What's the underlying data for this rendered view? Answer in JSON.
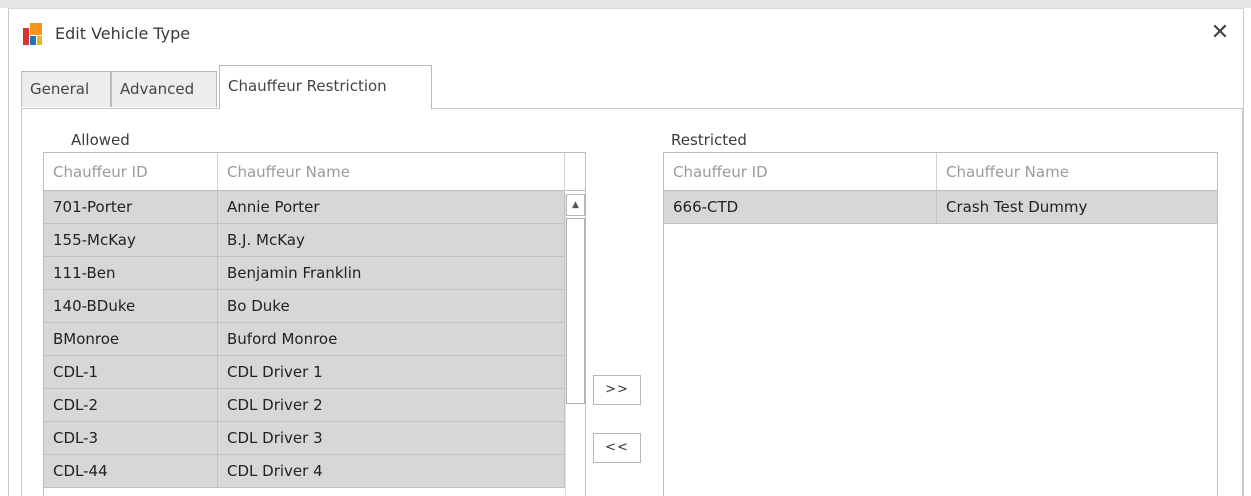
{
  "window": {
    "title": "Edit Vehicle Type"
  },
  "tabs": [
    {
      "label": "General"
    },
    {
      "label": "Advanced"
    },
    {
      "label": "Chauffeur Restriction"
    }
  ],
  "allowed": {
    "label": "Allowed",
    "columns": [
      "Chauffeur ID",
      "Chauffeur Name"
    ],
    "rows": [
      {
        "id": "701-Porter",
        "name": "Annie Porter"
      },
      {
        "id": "155-McKay",
        "name": "B.J. McKay"
      },
      {
        "id": "111-Ben",
        "name": "Benjamin Franklin"
      },
      {
        "id": "140-BDuke",
        "name": "Bo Duke"
      },
      {
        "id": "BMonroe",
        "name": "Buford Monroe"
      },
      {
        "id": "CDL-1",
        "name": "CDL Driver 1"
      },
      {
        "id": "CDL-2",
        "name": "CDL Driver 2"
      },
      {
        "id": "CDL-3",
        "name": "CDL Driver 3"
      },
      {
        "id": "CDL-44",
        "name": "CDL Driver 4"
      }
    ]
  },
  "restricted": {
    "label": "Restricted",
    "columns": [
      "Chauffeur ID",
      "Chauffeur Name"
    ],
    "rows": [
      {
        "id": "666-CTD",
        "name": "Crash Test Dummy"
      }
    ]
  },
  "buttons": {
    "add": ">>",
    "remove": "<<"
  },
  "icons": {
    "app": "app-logo-icon",
    "close": "close-icon",
    "scroll_up": "scroll-up-arrow-icon"
  },
  "colors": {
    "row_bg": "#d7d7d7",
    "header_text": "#9a9a9a",
    "border": "#bdbdbd"
  }
}
